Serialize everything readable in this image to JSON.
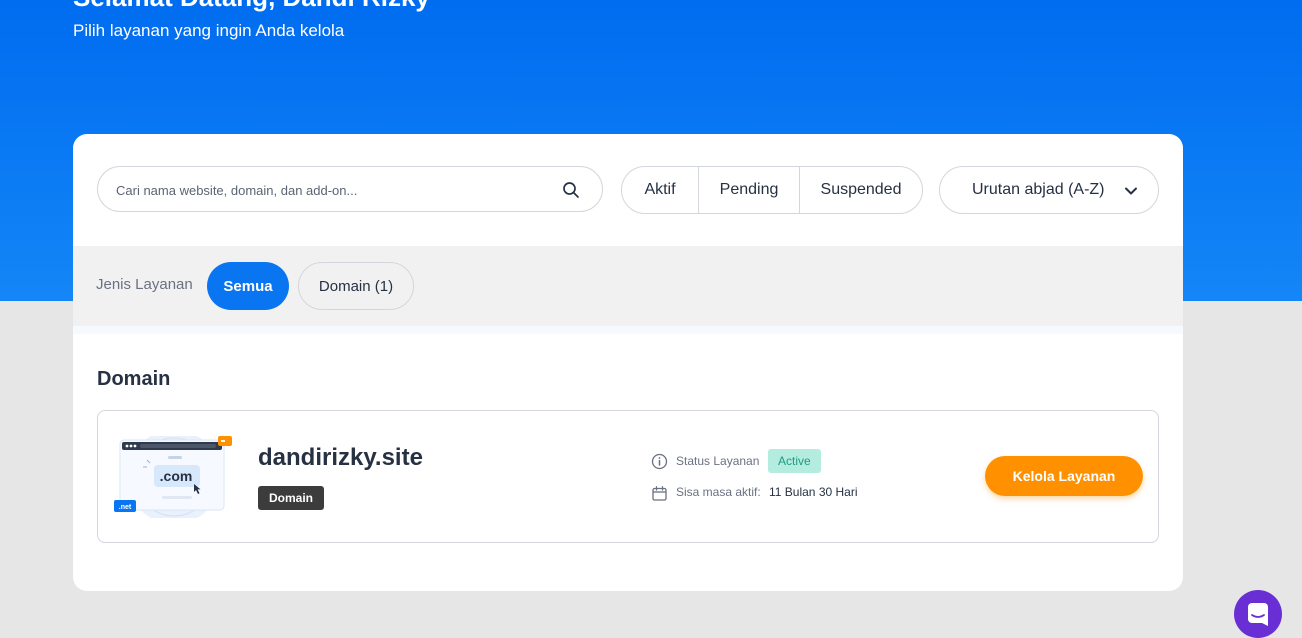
{
  "header": {
    "title": "Selamat Datang, Dandi Rizky",
    "subtitle": "Pilih layanan yang ingin Anda kelola"
  },
  "search": {
    "placeholder": "Cari nama website, domain, dan add-on...",
    "value": "",
    "icon": "search-icon"
  },
  "status_filters": [
    "Aktif",
    "Pending",
    "Suspended"
  ],
  "sort": {
    "selected": "Urutan abjad (A-Z)",
    "icon": "chevron-down-icon"
  },
  "service_type_filter": {
    "label": "Jenis Layanan",
    "options": [
      {
        "label": "Semua",
        "active": true
      },
      {
        "label": "Domain (1)",
        "active": false
      }
    ]
  },
  "section": {
    "title": "Domain"
  },
  "services": [
    {
      "domain": "dandirizky.site",
      "type": "Domain",
      "thumbnail": {
        "tld_main": ".com",
        "tld_corner": ".net"
      },
      "status_label": "Status Layanan",
      "status": "Active",
      "period_label": "Sisa masa aktif:",
      "period_value": "11 Bulan 30 Hari",
      "action_label": "Kelola Layanan"
    }
  ],
  "colors": {
    "hero": "#0a75f0",
    "primary": "#0a75f0",
    "accent": "#ff9100",
    "active_badge_bg": "#b5ece0",
    "active_badge_text": "#1d9c83",
    "chat": "#6a2fd4"
  },
  "chat": {
    "icon": "chat-icon"
  }
}
